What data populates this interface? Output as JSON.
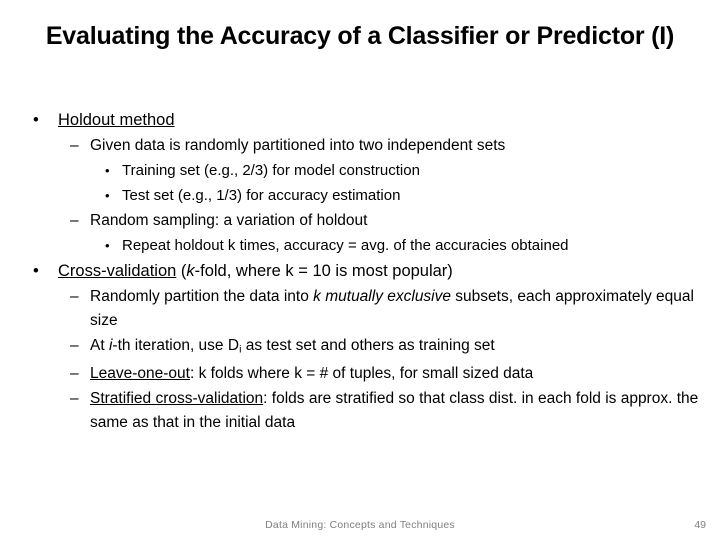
{
  "slide": {
    "title": "Evaluating the Accuracy of a Classifier or Predictor (I)",
    "page_number": "49",
    "footer_text": "Data Mining: Concepts and Techniques",
    "text_color": "#000000",
    "footer_color": "#808080",
    "background_color": "#ffffff"
  },
  "markers": {
    "level1": "•",
    "level2": "–",
    "level3": "•"
  },
  "content": {
    "items": [
      {
        "level": 1,
        "marker": "•",
        "text": "Holdout method",
        "underlined_head": "Holdout method",
        "rest": ""
      },
      {
        "level": 2,
        "marker": "–",
        "text": "Given data is randomly partitioned into two independent sets"
      },
      {
        "level": 3,
        "marker": "•",
        "text": "Training set (e.g., 2/3) for model construction"
      },
      {
        "level": 3,
        "marker": "•",
        "text": "Test set (e.g., 1/3) for accuracy estimation"
      },
      {
        "level": 2,
        "marker": "–",
        "text": "Random sampling: a variation of holdout"
      },
      {
        "level": 3,
        "marker": "•",
        "text": "Repeat holdout k times, accuracy = avg. of the accuracies obtained"
      },
      {
        "level": 1,
        "marker": "•",
        "text": "Cross-validation (k-fold, where k = 10 is most popular)",
        "underlined_head": "Cross-validation",
        "italic_part": "k",
        "rest": "-fold, where k = 10 is most popular)"
      },
      {
        "level": 2,
        "marker": "–",
        "text": "Randomly partition the data into k mutually exclusive subsets, each approximately equal size",
        "pre_italic": "Randomly partition the data into ",
        "italic_part": "k mutually exclusive",
        "post_italic": " subsets, each approximately equal size"
      },
      {
        "level": 2,
        "marker": "–",
        "text": "At i-th iteration, use Di as test set and others as training set",
        "pre_italic": "At ",
        "italic_part": "i",
        "post_italic": "-th iteration, use D",
        "subscript": "i",
        "tail": " as test set and others as training set"
      },
      {
        "level": 2,
        "marker": "–",
        "text": "Leave-one-out: k folds where k = # of tuples, for small sized data",
        "underlined_head": "Leave-one-out",
        "rest": ": k folds where k = # of tuples, for small sized data"
      },
      {
        "level": 2,
        "marker": "–",
        "text": "Stratified cross-validation: folds are stratified so that class dist. in each fold is approx. the same as that in the initial data",
        "underlined_head": "Stratified cross-validation",
        "rest": ": folds are stratified so that class dist. in each fold is approx. the same as that in the initial data"
      }
    ]
  }
}
